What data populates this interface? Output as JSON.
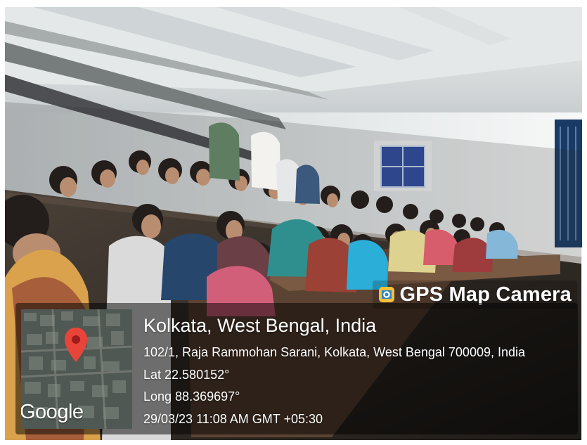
{
  "overlay": {
    "brand": "GPS Map Camera",
    "city": "Kolkata, West Bengal, India",
    "address": "102/1, Raja Rammohan Sarani, Kolkata, West Bengal 700009, India",
    "latitude": "Lat 22.580152°",
    "longitude": "Long 88.369697°",
    "timestamp": "29/03/23 11:08 AM GMT +05:30",
    "map_logo": "Google"
  },
  "icons": {
    "camera": "gps-map-camera-icon",
    "pin": "map-pin-icon"
  },
  "colors": {
    "panel": "#000000",
    "pin": "#e9443a",
    "brand_icon_bg": "#f5c13b",
    "brand_icon_fg": "#2f86c9"
  }
}
